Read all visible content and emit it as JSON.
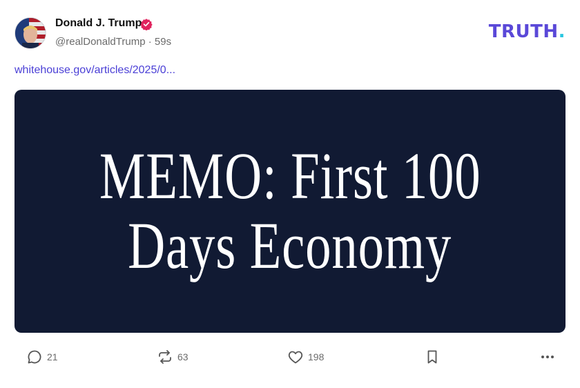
{
  "author": {
    "name": "Donald J. Trump",
    "handle": "@realDonaldTrump",
    "separator": "·",
    "time": "59s",
    "verified": true
  },
  "brand": {
    "logo_text": "TRUTH",
    "logo_dot": ".",
    "color": "#5a48d8",
    "dot_color": "#29c6e0"
  },
  "post": {
    "link_text": "whitehouse.gov/articles/2025/0...",
    "image": {
      "line1": "MEMO: First 100",
      "line2": "Days Economy",
      "background": "#111a33"
    }
  },
  "actions": {
    "reply": {
      "icon": "comment-icon",
      "count": "21"
    },
    "retruth": {
      "icon": "repost-icon",
      "count": "63"
    },
    "like": {
      "icon": "heart-icon",
      "count": "198"
    },
    "bookmark": {
      "icon": "bookmark-icon"
    },
    "more": {
      "icon": "more-icon"
    }
  },
  "colors": {
    "verified_badge": "#e0245e",
    "link": "#4a3fd6",
    "muted": "#6b6b6b"
  }
}
